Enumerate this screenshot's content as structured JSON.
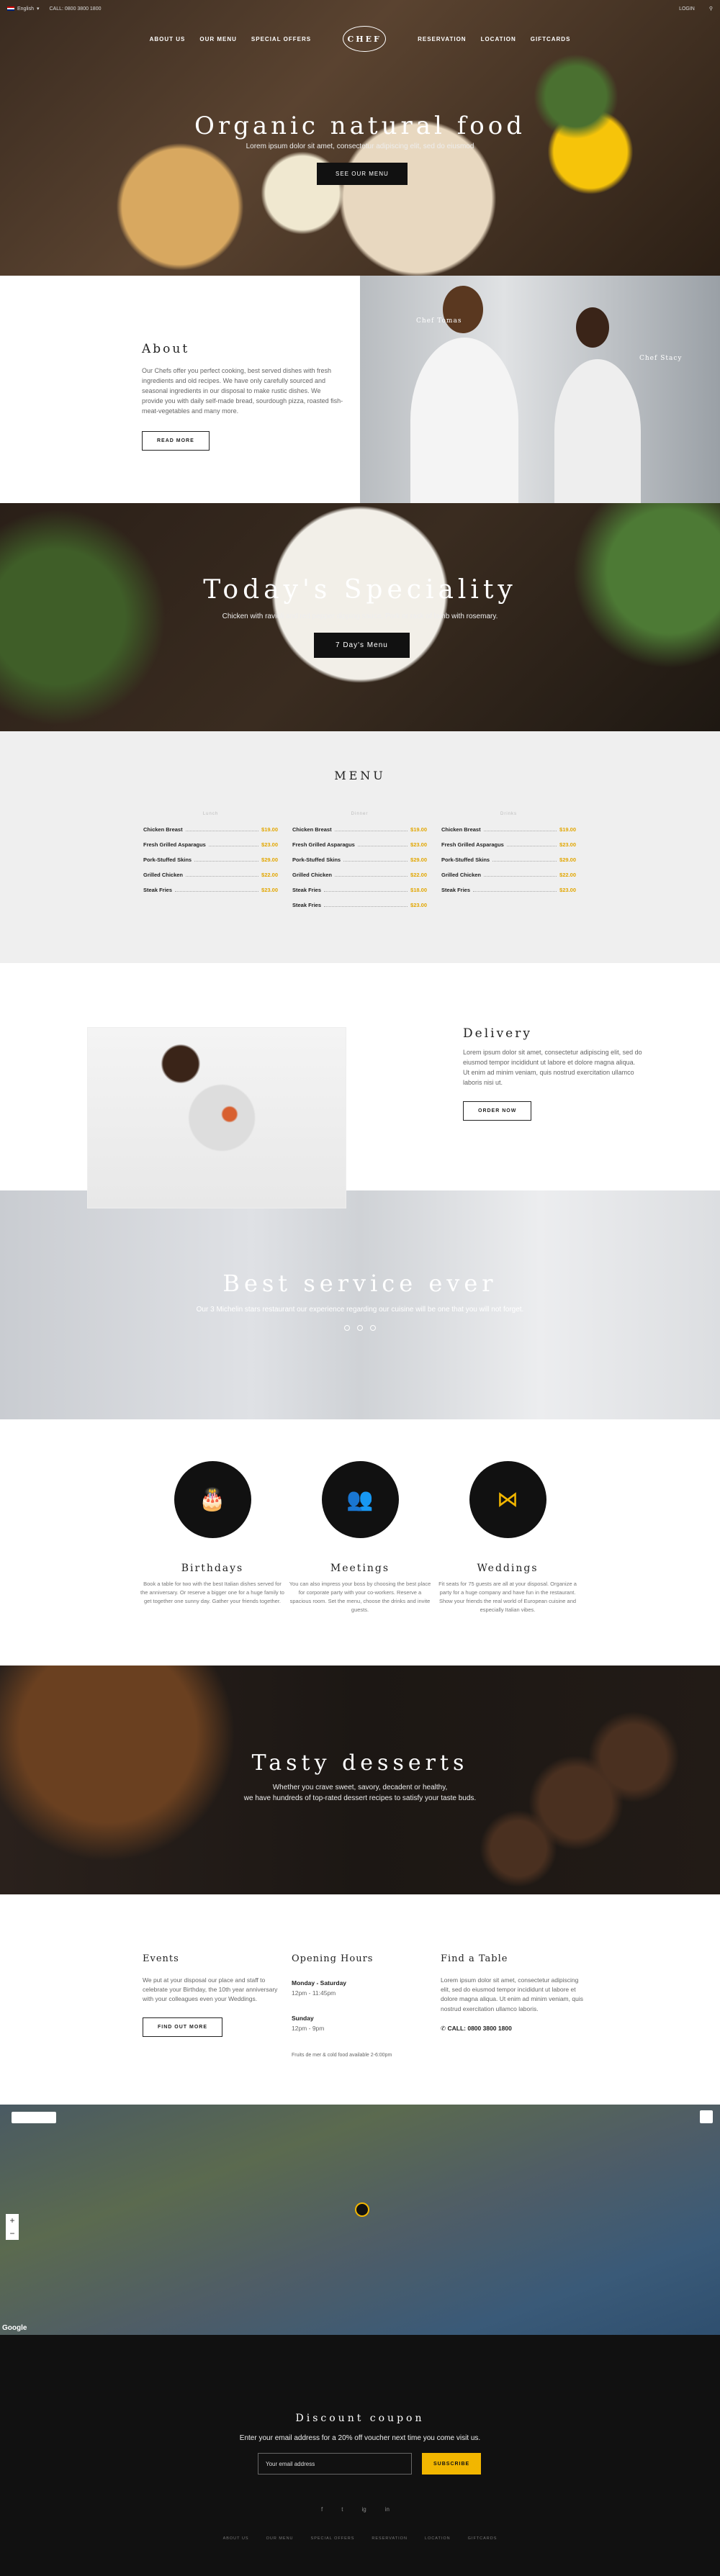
{
  "topbar": {
    "language": "English",
    "call": "CALL: 0800 3800 1800",
    "login": "LOGIN"
  },
  "nav": {
    "left": [
      "ABOUT US",
      "OUR MENU",
      "SPECIAL OFFERS"
    ],
    "logo": "CHEF",
    "right": [
      "RESERVATION",
      "LOCATION",
      "GIFTCARDS"
    ]
  },
  "hero": {
    "title": "Organic natural food",
    "subtitle": "Lorem ipsum dolor sit amet, consectetur adipiscing elit, sed do eiusmod",
    "button": "SEE OUR MENU"
  },
  "about": {
    "title": "About",
    "text": "Our Chefs offer you perfect cooking, best served dishes with fresh ingredients and old recipes. We have only carefully sourced and seasonal ingredients in our disposal to make rustic dishes. We provide you with daily self-made bread, sourdough pizza, roasted fish-meat-vegetables and many more.",
    "button": "READ MORE",
    "chef1": "Chef Tomas",
    "chef2": "Chef Stacy"
  },
  "special": {
    "title": "Today's Speciality",
    "text": "Chicken with ravioli and red pepper dipping sauce, Pork or rack of lamb with rosemary.",
    "button": "7 Day's Menu"
  },
  "menu": {
    "title": "MENU",
    "columns": [
      {
        "heading": "Lunch",
        "items": [
          {
            "name": "Chicken Breast",
            "price": "$19.00"
          },
          {
            "name": "Fresh Grilled Asparagus",
            "price": "$23.00"
          },
          {
            "name": "Pork-Stuffed Skins",
            "price": "$29.00"
          },
          {
            "name": "Grilled Chicken",
            "price": "$22.00"
          },
          {
            "name": "Steak Fries",
            "price": "$23.00"
          }
        ]
      },
      {
        "heading": "Dinner",
        "items": [
          {
            "name": "Chicken Breast",
            "price": "$19.00"
          },
          {
            "name": "Fresh Grilled Asparagus",
            "price": "$23.00"
          },
          {
            "name": "Pork-Stuffed Skins",
            "price": "$29.00"
          },
          {
            "name": "Grilled Chicken",
            "price": "$22.00"
          },
          {
            "name": "Steak Fries",
            "price": "$18.00"
          },
          {
            "name": "Steak Fries",
            "price": "$23.00"
          }
        ]
      },
      {
        "heading": "Drinks",
        "items": [
          {
            "name": "Chicken Breast",
            "price": "$19.00"
          },
          {
            "name": "Fresh Grilled Asparagus",
            "price": "$23.00"
          },
          {
            "name": "Pork-Stuffed Skins",
            "price": "$29.00"
          },
          {
            "name": "Grilled Chicken",
            "price": "$22.00"
          },
          {
            "name": "Steak Fries",
            "price": "$23.00"
          }
        ]
      }
    ]
  },
  "delivery": {
    "title": "Delivery",
    "text": "Lorem ipsum dolor sit amet, consectetur adipiscing elit, sed do eiusmod tempor incididunt ut labore et dolore magna aliqua. Ut enim ad minim veniam, quis nostrud exercitation ullamco laboris nisi ut.",
    "button": "ORDER NOW"
  },
  "service": {
    "title": "Best service ever",
    "text": "Our 3 Michelin stars restaurant our experience regarding our cuisine will be one that you will not forget."
  },
  "services": [
    {
      "icon": "cake-icon",
      "glyph": "🎂",
      "title": "Birthdays",
      "text": "Book a table for two with the best Italian dishes served for the anniversary. Or reserve a bigger one for a huge family to get together one sunny day. Gather your friends together."
    },
    {
      "icon": "meeting-icon",
      "glyph": "👥",
      "title": "Meetings",
      "text": "You can also impress your boss by choosing the best place for corporate party with your co-workers. Reserve a spacious room. Set the menu, choose the drinks and invite guests."
    },
    {
      "icon": "bowtie-icon",
      "glyph": "⋈",
      "title": "Weddings",
      "text": "Fit seats for 75 guests are all at your disposal. Organize a party for a huge company and have fun in the restaurant. Show your friends the real world of European cuisine and especially Italian vibes."
    }
  ],
  "desserts": {
    "title": "Tasty desserts",
    "line1": "Whether you crave sweet, savory, decadent or healthy,",
    "line2": "we have hundreds of top-rated dessert recipes to satisfy your taste buds."
  },
  "events": {
    "title": "Events",
    "text": "We put at your disposal our place and staff to celebrate your Birthday, the 10th year anniversary with your colleagues even your Weddings.",
    "button": "FIND OUT MORE"
  },
  "hours": {
    "title": "Opening Hours",
    "days1": "Monday - Saturday",
    "time1": "12pm - 11:45pm",
    "days2": "Sunday",
    "time2": "12pm - 9pm",
    "note": "Fruits de mer & cold food available 2-6:00pm"
  },
  "table": {
    "title": "Find a Table",
    "text": "Lorem ipsum dolor sit amet, consectetur adipiscing elit, sed do eiusmod tempor incididunt ut labore et dolore magna aliqua. Ut enim ad minim veniam, quis nostrud exercitation ullamco laboris.",
    "phone": "CALL: 0800 3800 1800"
  },
  "map": {
    "google": "Google"
  },
  "footer": {
    "title": "Discount coupon",
    "text": "Enter your email address for a 20% off voucher next time you come visit us.",
    "placeholder": "Your email address",
    "button": "SUBSCRIBE",
    "social": [
      "f",
      "t",
      "ig",
      "in"
    ],
    "nav": [
      "ABOUT US",
      "OUR MENU",
      "SPECIAL OFFERS",
      "RESERVATION",
      "LOCATION",
      "GIFTCARDS"
    ]
  }
}
